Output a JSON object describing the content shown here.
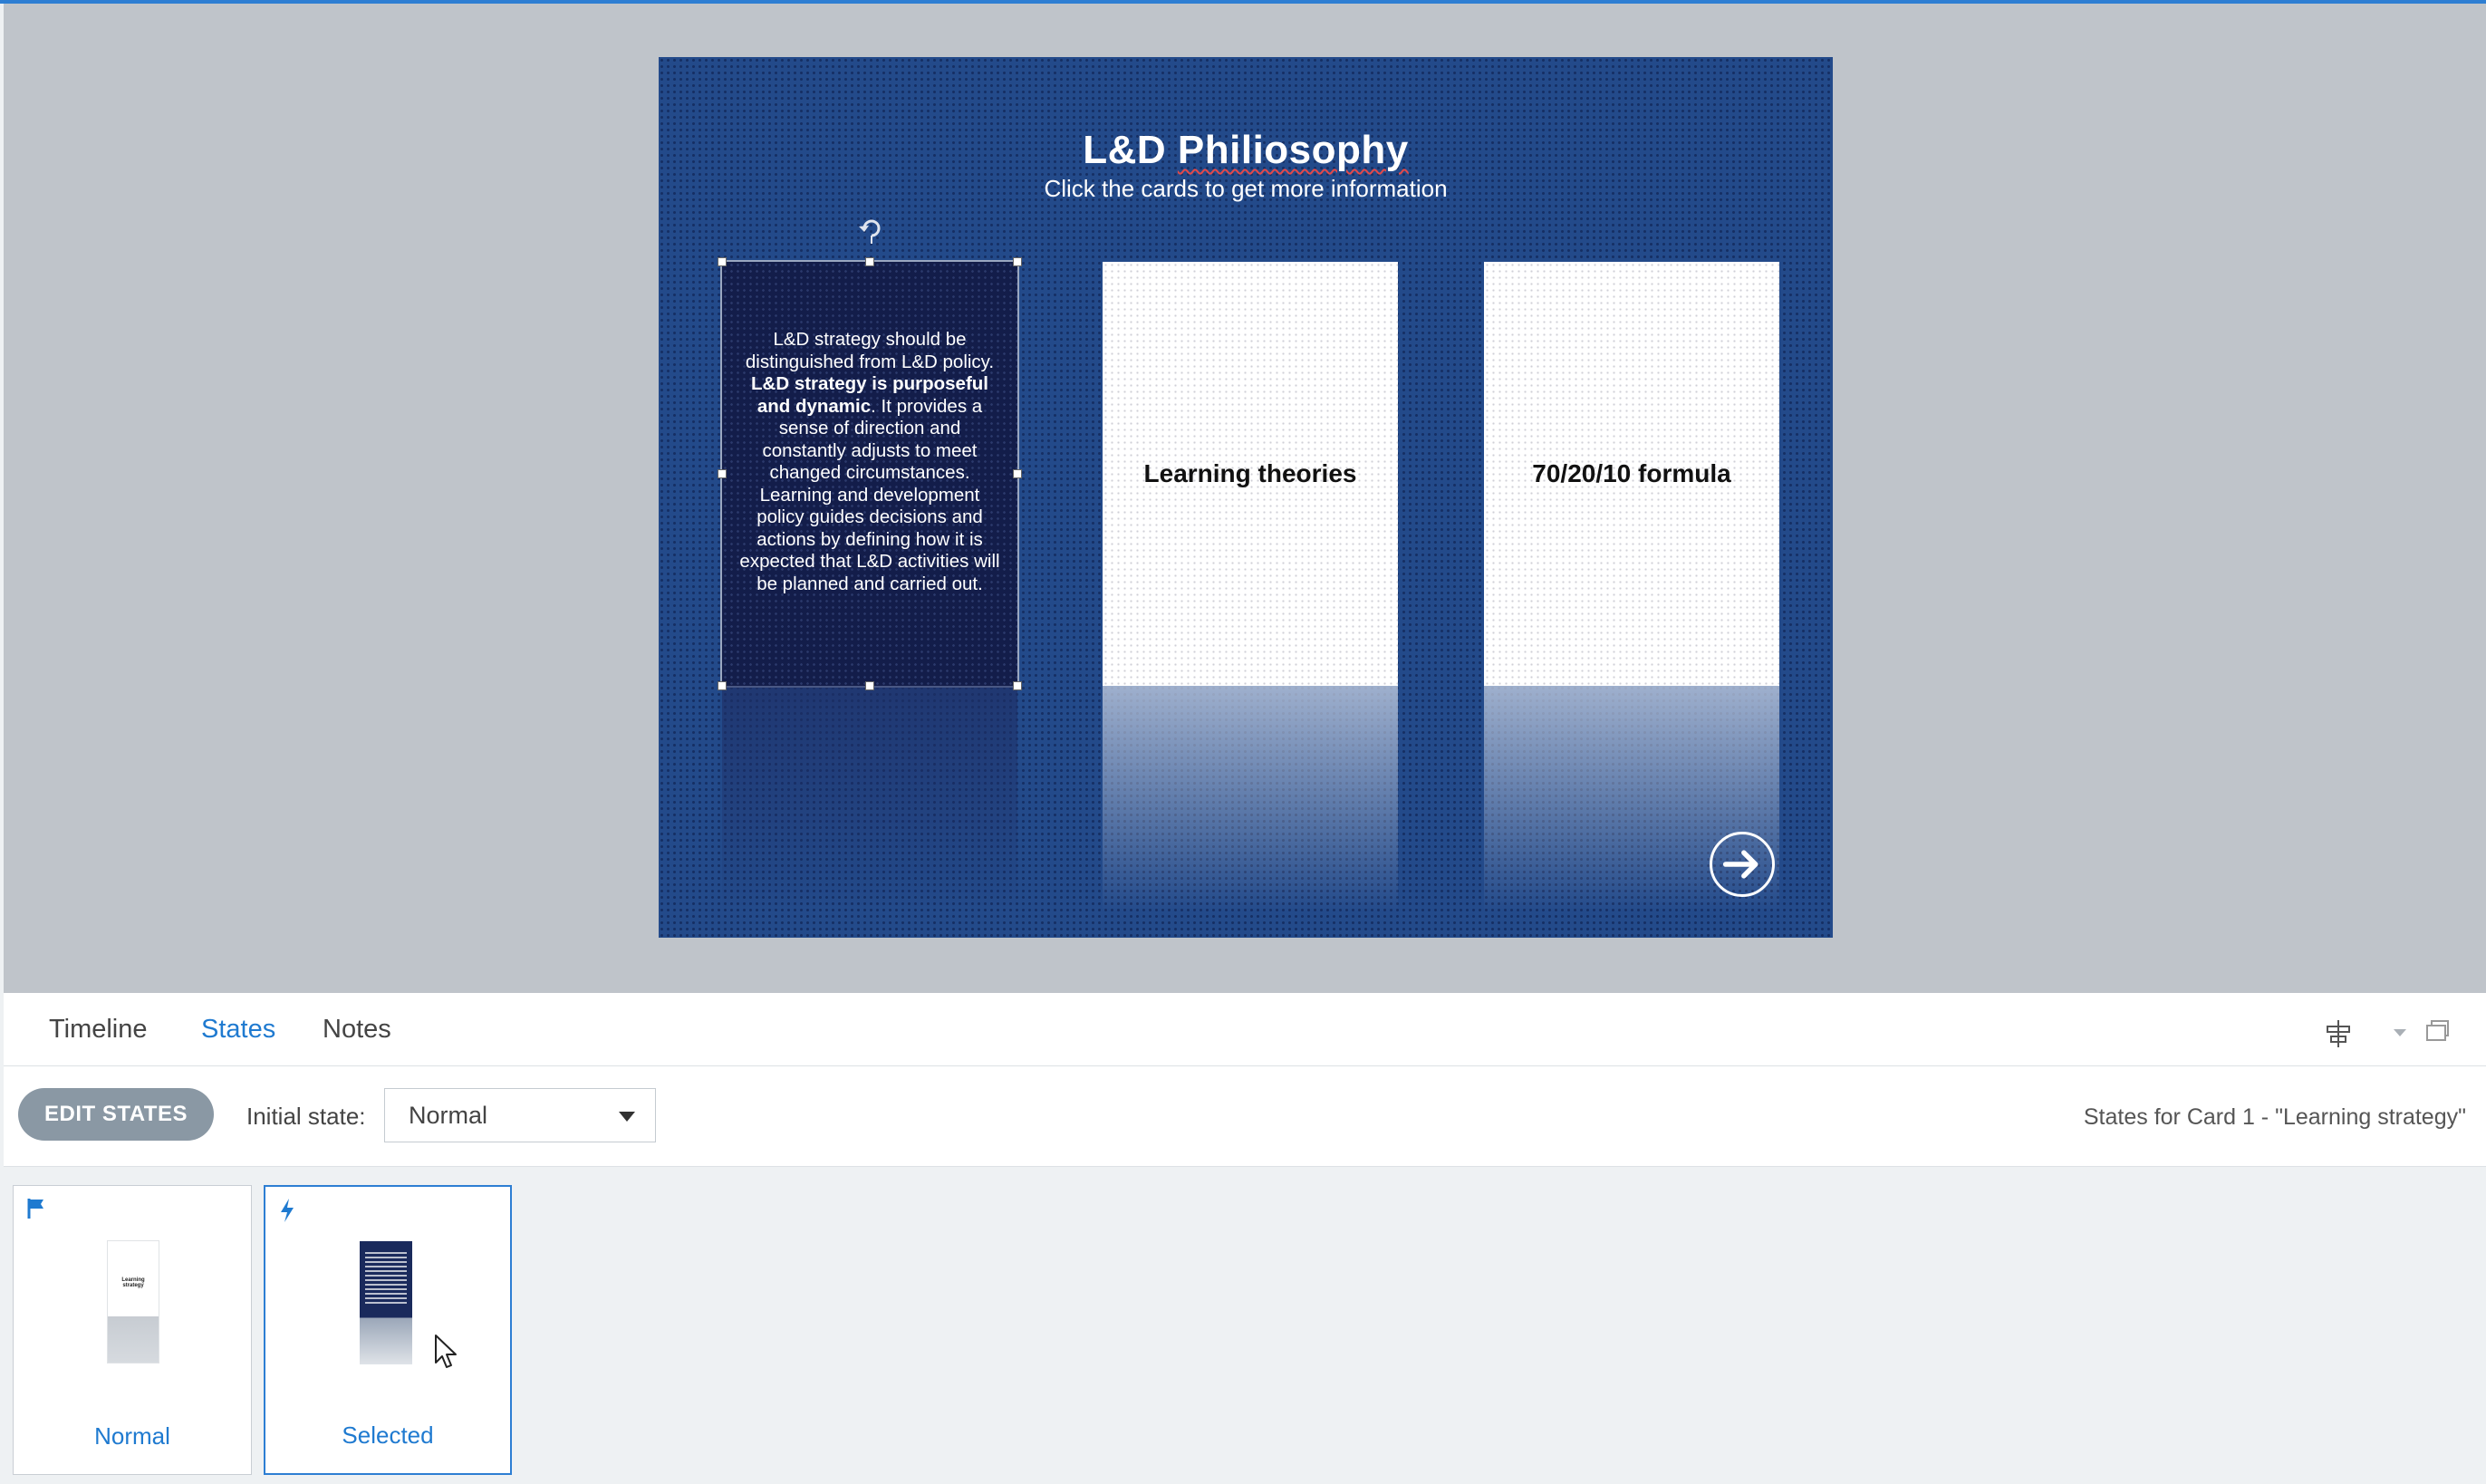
{
  "slide": {
    "title_prefix": "L&D ",
    "title_misspelled": "Philiosophy",
    "subtitle": "Click the cards to get more information",
    "card1_text_a": "L&D strategy should be distinguished from L&D policy. ",
    "card1_text_bold": "L&D strategy is purposeful and dynamic",
    "card1_text_b": ". It provides a sense of direction and constantly adjusts to meet changed circumstances. Learning and development policy guides decisions and actions by defining how it is expected that L&D activities will be planned and carried out.",
    "card2_label": "Learning theories",
    "card3_label": "70/20/10 formula"
  },
  "tabs": [
    {
      "label": "Timeline"
    },
    {
      "label": "States"
    },
    {
      "label": "Notes"
    }
  ],
  "toolbar": {
    "edit_states_label": "EDIT STATES",
    "initial_state_label": "Initial state:",
    "initial_state_value": "Normal",
    "states_for_text": "States for Card 1 - \"Learning strategy\""
  },
  "states": [
    {
      "label": "Normal",
      "icon": "flag-icon",
      "thumb_text": "Learning strategy"
    },
    {
      "label": "Selected",
      "icon": "lightning-icon"
    }
  ],
  "colors": {
    "accent": "#1f7ad0",
    "slide_bg": "#234a8a",
    "selected_card": "#131d4a"
  }
}
